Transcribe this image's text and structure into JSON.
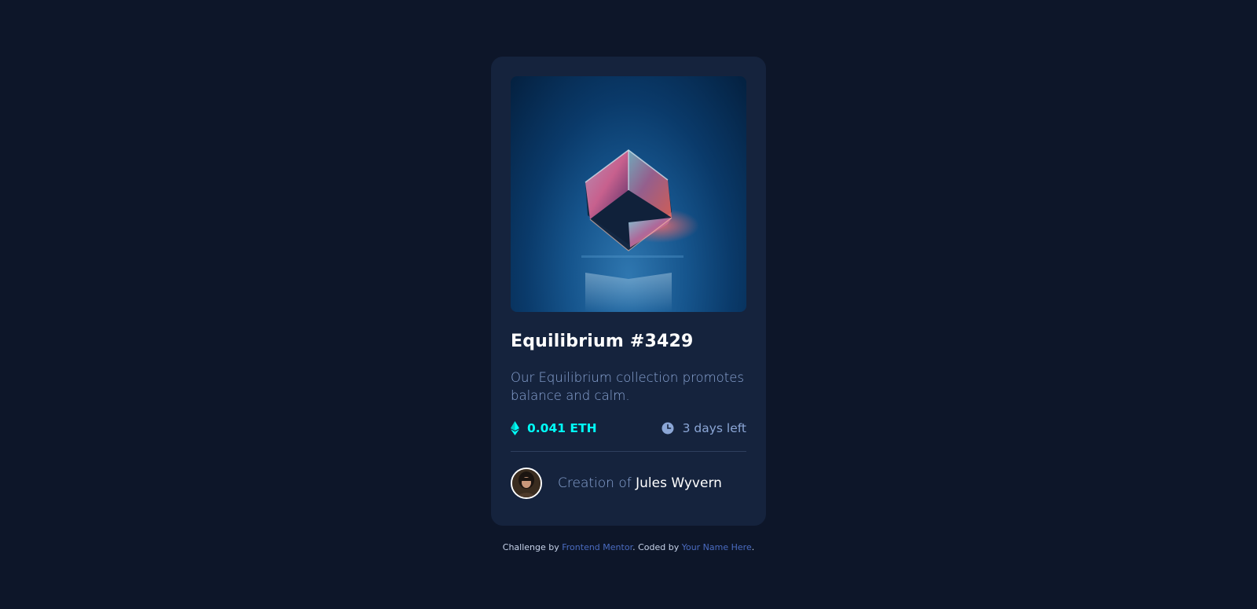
{
  "card": {
    "title": "Equilibrium #3429",
    "description": "Our Equilibrium collection promotes balance and calm.",
    "price": "0.041 ETH",
    "time_left": "3 days left",
    "creator_prefix": "Creation of",
    "creator_name": "Jules Wyvern"
  },
  "footer": {
    "challenge_prefix": "Challenge by",
    "challenge_link": "Frontend Mentor",
    "coded_prefix": ". Coded by",
    "coded_link": "Your Name Here",
    "suffix": "."
  },
  "icons": {
    "price": "ethereum-icon",
    "time": "clock-icon"
  },
  "colors": {
    "background": "#0d1629",
    "card": "#15233d",
    "accent": "#00fff8",
    "muted_text": "#8ba6d6",
    "link": "#4a6bc0"
  }
}
